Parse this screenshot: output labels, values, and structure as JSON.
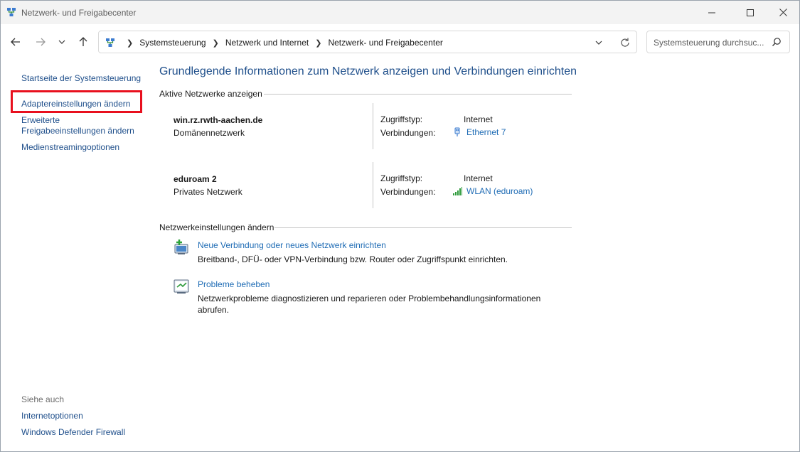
{
  "window": {
    "title": "Netzwerk- und Freigabecenter",
    "app_icon": "network-center-icon",
    "controls": [
      "minimize-icon",
      "maximize-icon",
      "close-icon"
    ]
  },
  "address_bar": {
    "breadcrumbs": [
      "Systemsteuerung",
      "Netzwerk und Internet",
      "Netzwerk- und Freigabecenter"
    ],
    "search_placeholder": "Systemsteuerung durchsuc..."
  },
  "sidebar": {
    "links": [
      "Startseite der Systemsteuerung",
      "Adaptereinstellungen ändern",
      "Erweiterte Freigabeeinstellungen ändern",
      "Medienstreamingoptionen"
    ],
    "highlighted_link": "Adaptereinstellungen ändern",
    "see_also_label": "Siehe auch",
    "see_also_links": [
      "Internetoptionen",
      "Windows Defender Firewall"
    ]
  },
  "main": {
    "title": "Grundlegende Informationen zum Netzwerk anzeigen und Verbindungen einrichten",
    "active_networks_header": "Aktive Netzwerke anzeigen",
    "networks": [
      {
        "name": "win.rz.rwth-aachen.de",
        "type": "Domänennetzwerk",
        "access_label": "Zugriffstyp:",
        "access_value": "Internet",
        "connections_label": "Verbindungen:",
        "connection": "Ethernet 7",
        "connection_icon": "ethernet-icon"
      },
      {
        "name": "eduroam 2",
        "type": "Privates Netzwerk",
        "access_label": "Zugriffstyp:",
        "access_value": "Internet",
        "connections_label": "Verbindungen:",
        "connection": "WLAN (eduroam)",
        "connection_icon": "wifi-signal-icon"
      }
    ],
    "settings_header": "Netzwerkeinstellungen ändern",
    "tasks": [
      {
        "link": "Neue Verbindung oder neues Netzwerk einrichten",
        "description": "Breitband-, DFÜ- oder VPN-Verbindung bzw. Router oder Zugriffspunkt einrichten.",
        "icon": "new-connection-icon"
      },
      {
        "link": "Probleme beheben",
        "description": "Netzwerkprobleme diagnostizieren und reparieren oder Problembehandlungsinformationen abrufen.",
        "icon": "troubleshoot-icon"
      }
    ]
  },
  "colors": {
    "link": "#1f6cb5",
    "title": "#1f4f8b",
    "highlight": "#e8101e"
  }
}
